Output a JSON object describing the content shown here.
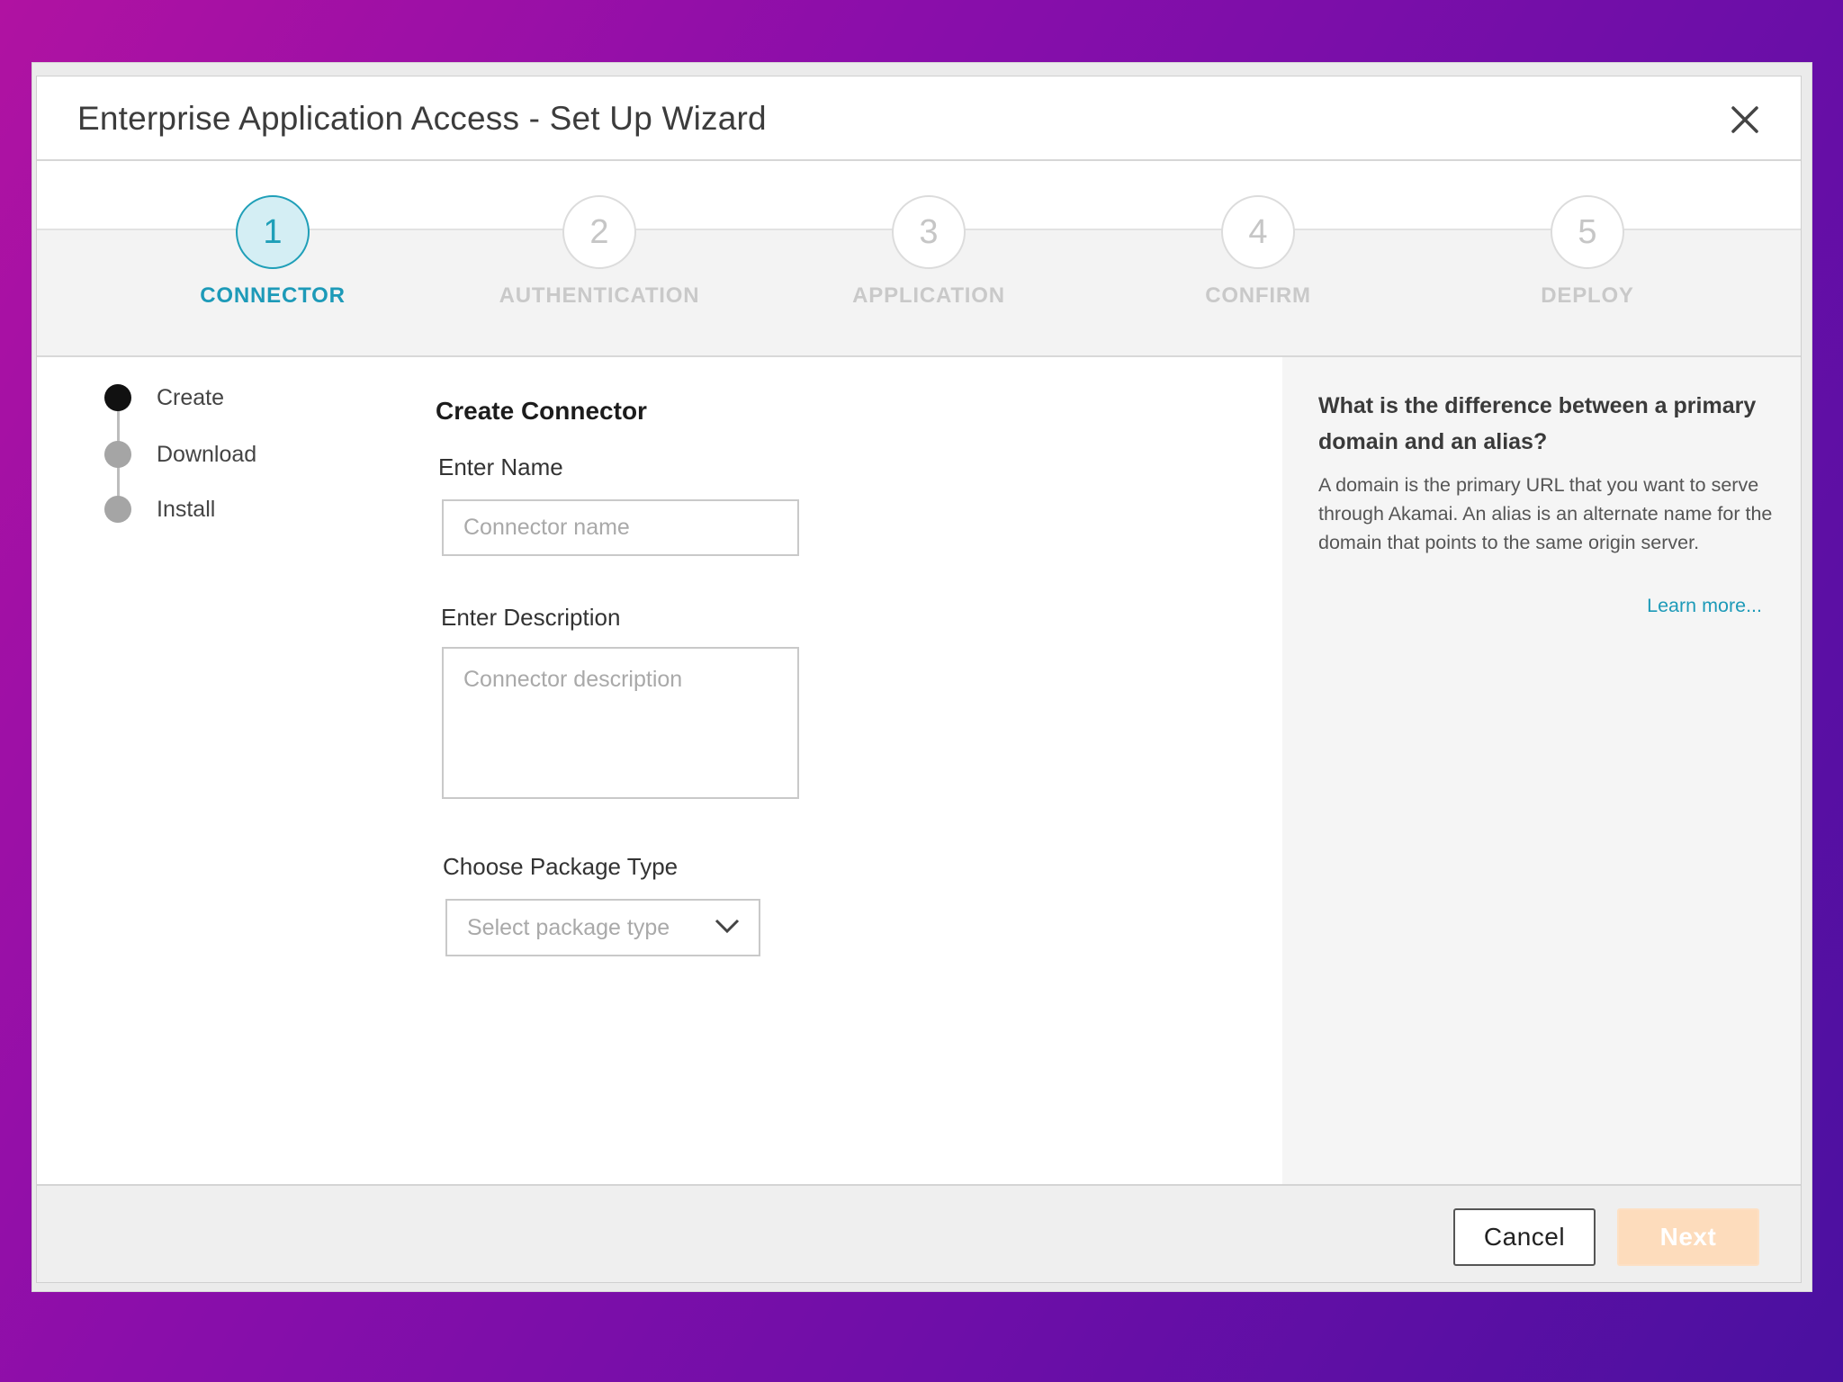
{
  "dialog": {
    "title": "Enterprise Application Access - Set Up Wizard"
  },
  "stepper": {
    "steps": [
      {
        "number": "1",
        "label": "CONNECTOR",
        "active": true
      },
      {
        "number": "2",
        "label": "AUTHENTICATION",
        "active": false
      },
      {
        "number": "3",
        "label": "APPLICATION",
        "active": false
      },
      {
        "number": "4",
        "label": "CONFIRM",
        "active": false
      },
      {
        "number": "5",
        "label": "DEPLOY",
        "active": false
      }
    ]
  },
  "substeps": [
    {
      "label": "Create",
      "active": true
    },
    {
      "label": "Download",
      "active": false
    },
    {
      "label": "Install",
      "active": false
    }
  ],
  "form": {
    "title": "Create Connector",
    "name_label": "Enter Name",
    "name_placeholder": "Connector name",
    "name_value": "",
    "description_label": "Enter Description",
    "description_placeholder": "Connector description",
    "description_value": "",
    "package_label": "Choose Package Type",
    "package_placeholder": "Select package type"
  },
  "help": {
    "title": "What is the difference between a primary domain and an alias?",
    "body": "A domain is the primary URL that you want to serve through Akamai. An alias is an alternate name for the domain that points to the same origin server.",
    "link": "Learn more..."
  },
  "footer": {
    "cancel_label": "Cancel",
    "next_label": "Next"
  },
  "colors": {
    "accent": "#1d9ab8",
    "active_step_fill": "#d4eef4",
    "next_disabled": "#fddcbc",
    "background_gradient_start": "#b012a2",
    "background_gradient_end": "#4a10a0"
  }
}
